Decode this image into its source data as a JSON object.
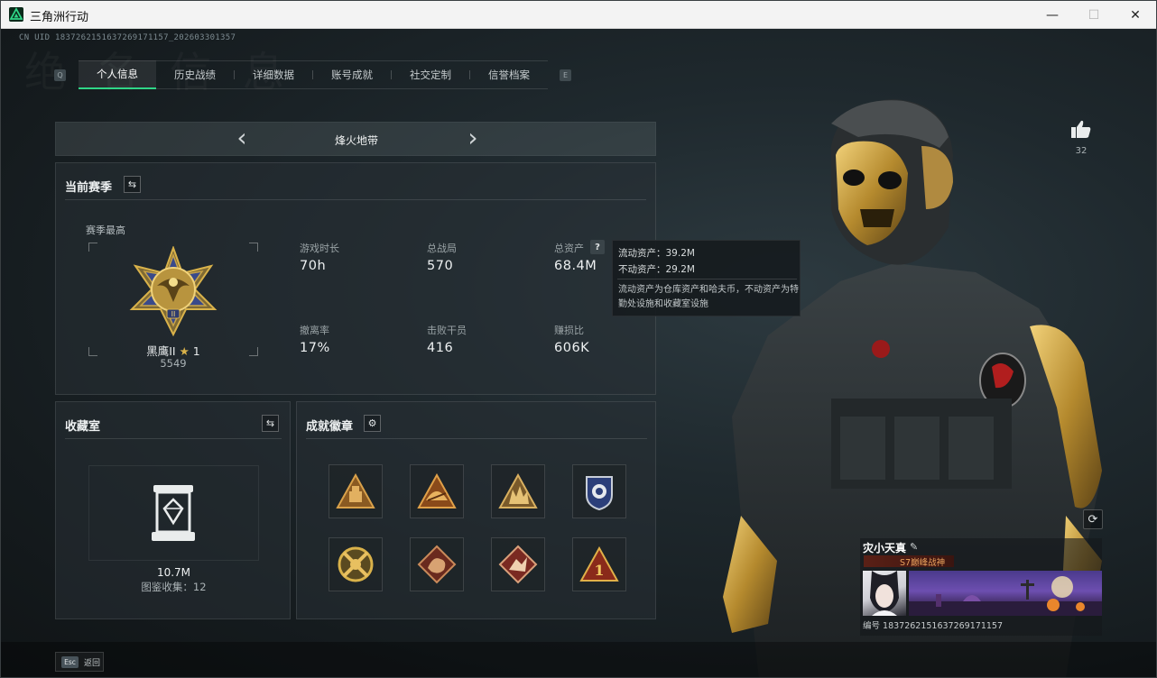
{
  "window": {
    "title": "三角洲行动",
    "controls": {
      "minimize": "—",
      "maximize": "☐",
      "close": "✕"
    }
  },
  "header": {
    "uid": "CN UID 1837262151637269171157_202603301357",
    "watermark": "绝 名 信 息"
  },
  "tabs": {
    "key_left": "Q",
    "key_right": "E",
    "items": [
      {
        "label": "个人信息",
        "active": true
      },
      {
        "label": "历史战绩",
        "active": false
      },
      {
        "label": "详细数据",
        "active": false
      },
      {
        "label": "账号成就",
        "active": false
      },
      {
        "label": "社交定制",
        "active": false
      },
      {
        "label": "信誉档案",
        "active": false
      }
    ]
  },
  "mode_selector": {
    "title": "烽火地带",
    "prev_icon": "chevron-left-icon",
    "next_icon": "chevron-right-icon"
  },
  "season": {
    "title": "当前赛季",
    "best_label": "赛季最高",
    "rank_name": "黑鹰II",
    "rank_stars": "1",
    "rank_score": "5549",
    "stats": [
      {
        "label": "游戏时长",
        "value": "70h"
      },
      {
        "label": "总战局",
        "value": "570"
      },
      {
        "label": "总资产",
        "value": "68.4M"
      },
      {
        "label": "撤离率",
        "value": "17%"
      },
      {
        "label": "击败干员",
        "value": "416"
      },
      {
        "label": "赚损比",
        "value": "606K"
      }
    ],
    "help": "?"
  },
  "tooltip": {
    "liquid": "流动资产：39.2M",
    "fixed": "不动资产：29.2M",
    "description": "流动资产为仓库资产和哈夫币，不动资产为特勤处设施和收藏室设施"
  },
  "collection": {
    "title": "收藏室",
    "value": "10.7M",
    "count": "图鉴收集：12"
  },
  "badges": {
    "title": "成就徽章",
    "items": [
      "badge-1",
      "badge-2",
      "badge-3",
      "badge-4",
      "badge-5",
      "badge-6",
      "badge-7",
      "badge-8"
    ]
  },
  "social": {
    "likes": "32"
  },
  "player": {
    "name": "灾小天真",
    "tag": "S7巅峰战神",
    "id": "编号 1837262151637269171157"
  },
  "footer": {
    "esc_key": "Esc",
    "esc_label": "返回"
  },
  "colors": {
    "accent": "#2fd687",
    "gold": "#d9b24a",
    "bg": "#1f292e"
  }
}
